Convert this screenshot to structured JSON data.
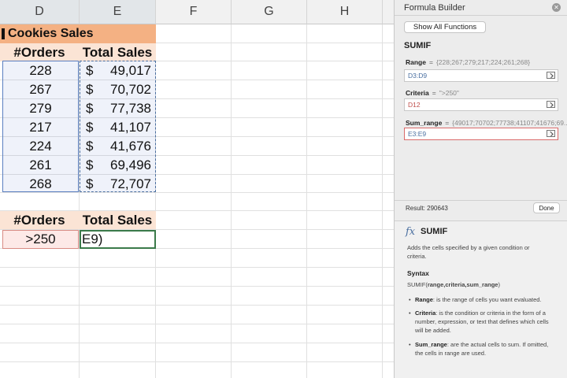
{
  "columns": [
    "D",
    "E",
    "F",
    "G",
    "H"
  ],
  "table_title": "Cookies Sales",
  "headers": {
    "orders": "#Orders",
    "total": "Total Sales"
  },
  "rows": [
    {
      "orders": "228",
      "currency": "$",
      "total": "49,017"
    },
    {
      "orders": "267",
      "currency": "$",
      "total": "70,702"
    },
    {
      "orders": "279",
      "currency": "$",
      "total": "77,738"
    },
    {
      "orders": "217",
      "currency": "$",
      "total": "41,107"
    },
    {
      "orders": "224",
      "currency": "$",
      "total": "41,676"
    },
    {
      "orders": "261",
      "currency": "$",
      "total": "69,496"
    },
    {
      "orders": "268",
      "currency": "$",
      "total": "72,707"
    }
  ],
  "lower_headers": {
    "orders": "#Orders",
    "total": "Total Sales"
  },
  "criteria_cell": ">250",
  "active_cell": "E9)",
  "panel": {
    "title": "Formula Builder",
    "show_all_label": "Show All Functions",
    "function_name": "SUMIF",
    "args": [
      {
        "name": "Range",
        "eq": "=",
        "values": "{228;267;279;217;224;261;268}",
        "input": "D3:D9"
      },
      {
        "name": "Criteria",
        "eq": "=",
        "values": "\">250\"",
        "input": "D12"
      },
      {
        "name": "Sum_range",
        "eq": "=",
        "values": "{49017;70702;77738;41107;41676;69...",
        "input": "E3:E9"
      }
    ],
    "result": "Result: 290643",
    "done_label": "Done",
    "help": {
      "fx": "fx",
      "name": "SUMIF",
      "description_1": "Adds the cells specified by a given condition or",
      "description_2": "criteria.",
      "syntax_title": "Syntax",
      "syntax_prefix": "SUMIF(",
      "syntax_args": "range,criteria,sum_range",
      "syntax_suffix": ")",
      "b1_term": "Range",
      "b1_text": ": is the range of cells you want evaluated.",
      "b2_term": "Criteria",
      "b2_text": ": is the condition or criteria in the form of a number, expression, or text that defines which cells will be added.",
      "b3_term": "Sum_range",
      "b3_text": ": are the actual cells to sum. If omitted, the cells in range are used."
    }
  }
}
